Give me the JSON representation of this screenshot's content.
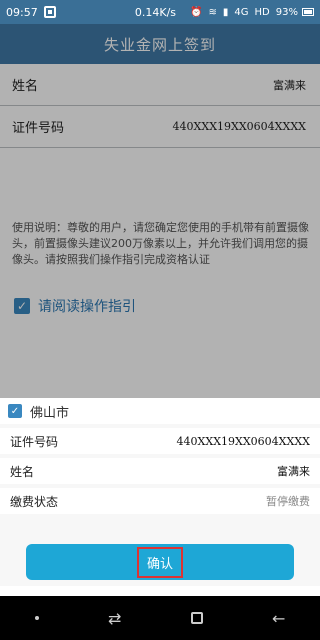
{
  "status": {
    "time": "09:57",
    "network": "0.14K/s",
    "signal": "4G",
    "hd": "HD",
    "battery": "93%"
  },
  "app_bar": {
    "title": "失业金网上签到"
  },
  "form": {
    "rows": [
      {
        "label": "姓名",
        "value": "富满来"
      },
      {
        "label": "证件号码",
        "value": "440XXX19XX0604XXXX"
      }
    ],
    "info_text": "使用说明：尊敬的用户，请您确定您使用的手机带有前置摄像头，前置摄像头建议200万像素以上，并允许我们调用您的摄像头。请按照我们操作指引完成资格认证",
    "guide_label": "请阅读操作指引"
  },
  "sheet": {
    "city": "佛山市",
    "rows": [
      {
        "label": "证件号码",
        "value": "440XXX19XX0604XXXX"
      },
      {
        "label": "姓名",
        "value": "富满来"
      },
      {
        "label": "缴费状态",
        "value": "暂停缴费"
      }
    ],
    "confirm_label": "确认"
  },
  "icons": [
    "qr-icon",
    "alarm-icon",
    "wifi-icon",
    "signal-icon",
    "battery-icon",
    "check-icon",
    "menu-dot-icon",
    "switch-icon",
    "recent-apps-icon",
    "back-icon"
  ]
}
